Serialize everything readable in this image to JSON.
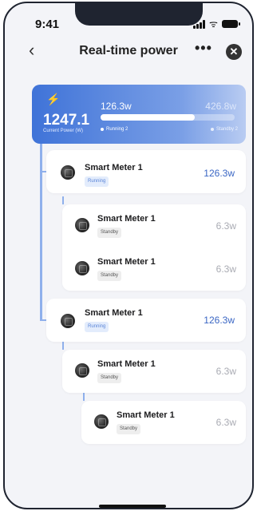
{
  "status_bar": {
    "time": "9:41"
  },
  "header": {
    "title": "Real-time power",
    "more": "•••",
    "back": "‹",
    "close": "✕"
  },
  "summary": {
    "total_power": "1247.1",
    "total_label": "Current Power (W)",
    "running_power": "126.3w",
    "standby_power": "426.8w",
    "running_legend": "Running 2",
    "standby_legend": "Standby 2",
    "running_fraction": 0.7
  },
  "devices": [
    {
      "name": "Smart Meter 1",
      "status": "Running",
      "power": "126.3w"
    },
    {
      "name": "Smart Meter 1",
      "status": "Standby",
      "power": "6.3w"
    },
    {
      "name": "Smart Meter 1",
      "status": "Standby",
      "power": "6.3w"
    },
    {
      "name": "Smart Meter 1",
      "status": "Running",
      "power": "126.3w"
    },
    {
      "name": "Smart Meter 1",
      "status": "Standby",
      "power": "6.3w"
    },
    {
      "name": "Smart Meter 1",
      "status": "Standby",
      "power": "6.3w"
    }
  ],
  "colors": {
    "accent": "#3f73d8",
    "running_text": "#3a66c4",
    "standby_text": "#a9abb3"
  }
}
